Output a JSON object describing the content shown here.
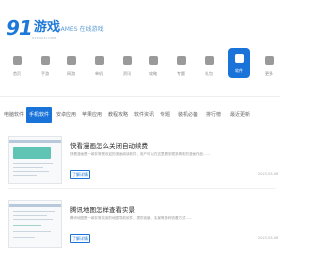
{
  "header": {
    "logo_number": "91",
    "logo_text": "游戏",
    "logo_sub": "91YOUXI.COM",
    "slogan": "GAMES 在线游戏"
  },
  "nav": {
    "items": [
      {
        "label": "首页",
        "icon": "home-icon"
      },
      {
        "label": "手游",
        "icon": "mobile-game-icon"
      },
      {
        "label": "网游",
        "icon": "online-game-icon"
      },
      {
        "label": "单机",
        "icon": "console-game-icon"
      },
      {
        "label": "资讯",
        "icon": "news-icon"
      },
      {
        "label": "攻略",
        "icon": "guide-icon"
      },
      {
        "label": "专题",
        "icon": "topic-icon"
      },
      {
        "label": "礼包",
        "icon": "gift-icon"
      },
      {
        "label": "软件",
        "icon": "software-icon",
        "active": true
      },
      {
        "label": "更多",
        "icon": "more-icon"
      }
    ]
  },
  "tabs": {
    "items": [
      {
        "label": "电脑软件"
      },
      {
        "label": "手机软件",
        "active": true
      },
      {
        "label": "安卓应用"
      },
      {
        "label": "苹果应用"
      },
      {
        "label": "教程攻略"
      },
      {
        "label": "软件资讯"
      },
      {
        "label": "专题"
      },
      {
        "label": "装机必备"
      },
      {
        "label": "排行榜"
      },
      {
        "label": "最近更新"
      }
    ]
  },
  "articles": [
    {
      "title": "快看漫画怎么关闭自动续费",
      "desc": "快看漫画是一款非常受欢迎的漫画阅读软件，用户可以在这里看到很多精彩的漫画作品……",
      "button": "了解详情",
      "date": "2023-05-06"
    },
    {
      "title": "腾讯地图怎样查看实景",
      "desc": "腾讯地图是一款非常实用的地图导航软件，提供街景、实景等多种查看方式……",
      "button": "了解详情",
      "date": "2023-05-06"
    }
  ],
  "colors": {
    "accent": "#1a73d9",
    "logo": "#1e78d8",
    "thumb_panel": "#5fc4b3"
  }
}
